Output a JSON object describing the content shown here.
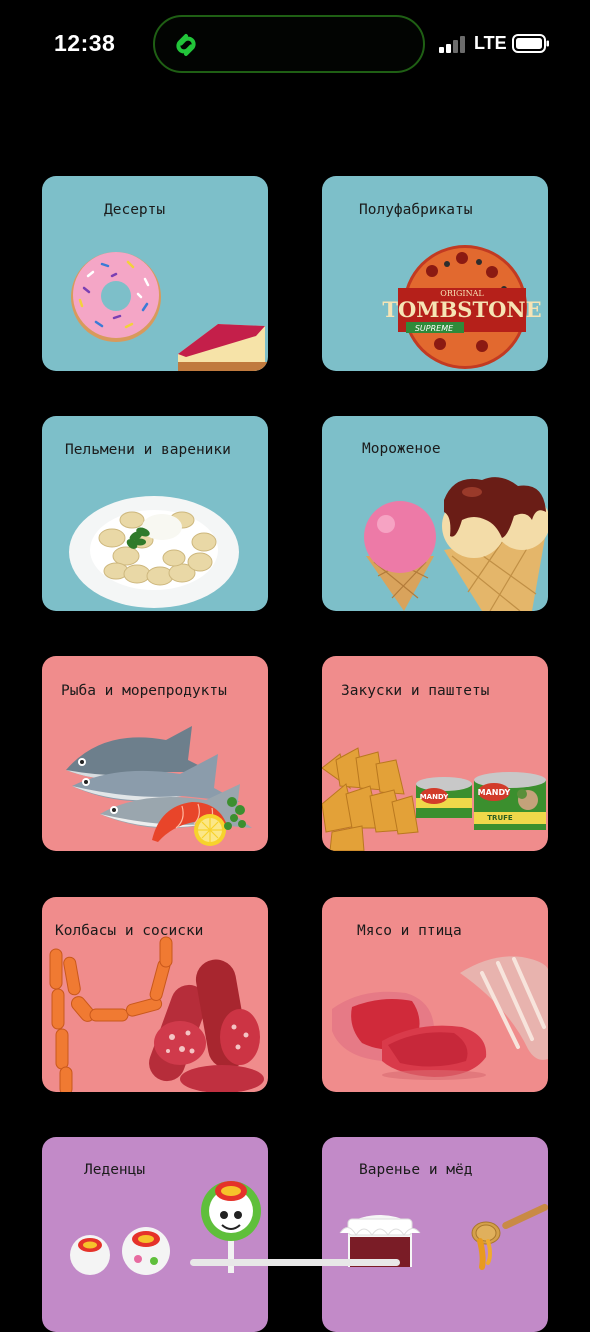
{
  "status_bar": {
    "time": "12:38",
    "network": "LTE",
    "signal_bars_active": 2,
    "signal_bars_total": 4,
    "island_icon": "link-rings-icon",
    "island_accent": "#22c53a"
  },
  "categories": [
    {
      "label": "Десерты",
      "icon": "donut-cake-icon",
      "color": "#7dbfc9"
    },
    {
      "label": "Полуфабрикаты",
      "icon": "frozen-pizza-icon",
      "color": "#7dbfc9"
    },
    {
      "label": "Пельмени и вареники",
      "icon": "dumplings-plate-icon",
      "color": "#7dbfc9"
    },
    {
      "label": "Мороженое",
      "icon": "ice-cream-icon",
      "color": "#7dbfc9"
    },
    {
      "label": "Рыба и морепродукты",
      "icon": "fish-icon",
      "color": "#f08c8c"
    },
    {
      "label": "Закуски и паштеты",
      "icon": "snacks-pate-icon",
      "color": "#f08c8c"
    },
    {
      "label": "Колбасы и сосиски",
      "icon": "sausage-icon",
      "color": "#f08c8c"
    },
    {
      "label": "Мясо и птица",
      "icon": "meat-icon",
      "color": "#f08c8c"
    },
    {
      "label": "Леденцы",
      "icon": "lollipop-icon",
      "color": "#c28ac8"
    },
    {
      "label": "Варенье и мёд",
      "icon": "jam-honey-icon",
      "color": "#c28ac8"
    }
  ],
  "product_labels": {
    "pizza_brand": "TOMBSTONE",
    "pizza_brand_top": "ORIGINAL",
    "pizza_variant": "SUPREME",
    "pate_brand": "MANDY",
    "pate_flavor": "TRUFE"
  }
}
